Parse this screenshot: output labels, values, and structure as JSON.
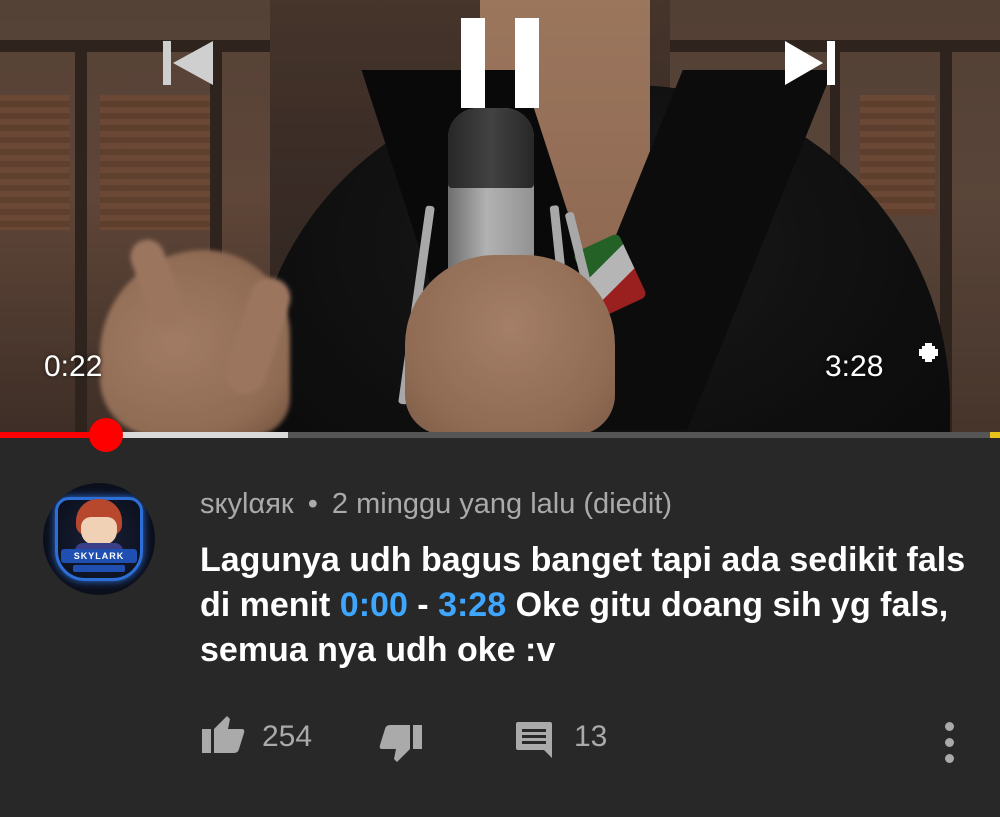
{
  "player": {
    "current_time": "0:22",
    "duration": "3:28",
    "progress_fraction": 0.106,
    "buffered_fraction": 0.288,
    "state": "playing",
    "accent_color": "#ff0000",
    "controls": {
      "previous_icon": "skip-previous-icon",
      "pause_icon": "pause-icon",
      "next_icon": "skip-next-icon",
      "fullscreen_icon": "fullscreen-icon"
    }
  },
  "comment": {
    "author": "ѕкуlαяк",
    "separator": "•",
    "time_ago": "2 minggu yang lalu (diedit)",
    "avatar_label": "SKYLARK",
    "text_part1": "Lagunya udh bagus banget tapi ada sedikit fals di menit ",
    "timestamp1": "0:00",
    "text_dash": " - ",
    "timestamp2": "3:28",
    "text_part2": " Oke gitu doang sih yg fals, semua nya udh oke :v",
    "link_color": "#3ea6ff",
    "likes": "254",
    "replies": "13",
    "icons": {
      "like": "thumbs-up-icon",
      "dislike": "thumbs-down-icon",
      "reply": "comment-icon",
      "menu": "more-vert-icon"
    }
  }
}
